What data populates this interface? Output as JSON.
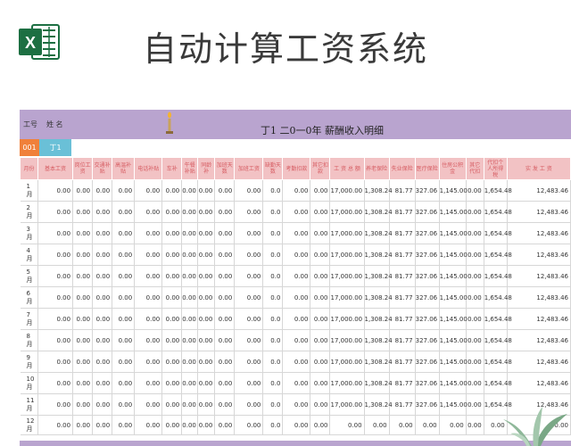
{
  "banner": {
    "title": "自动计算工资系统",
    "logo_letter": "X"
  },
  "sheet": {
    "header": {
      "emp_no_label": "工号",
      "name_label": "姓  名",
      "title": "丁1  二0一0年  薪酬收入明细"
    },
    "employee": {
      "id": "001",
      "name": "丁1"
    },
    "columns": [
      "月份",
      "基本工资",
      "岗位工资",
      "交通补贴",
      "高温补贴",
      "电话补贴",
      "车补",
      "午餐补贴",
      "同龄补",
      "加班天数",
      "加班工资",
      "缺勤天数",
      "考勤扣款",
      "其它扣款",
      "工 资 总 额",
      "养老保险",
      "失业保险",
      "医疗保险",
      "住房公积金",
      "其它代扣",
      "代扣个人所得税",
      "实 发 工 资"
    ],
    "rows": [
      {
        "month": "1月",
        "cells": [
          "0.00",
          "0.00",
          "0.00",
          "0.00",
          "0.00",
          "0.00",
          "0.00",
          "0.00",
          "0.00",
          "0.00",
          "0.0",
          "0.00",
          "0.00",
          "17,000.00",
          "1,308.24",
          "81.77",
          "327.06",
          "1,145.00",
          "0.00",
          "1,654.48",
          "12,483.46"
        ]
      },
      {
        "month": "2月",
        "cells": [
          "0.00",
          "0.00",
          "0.00",
          "0.00",
          "0.00",
          "0.00",
          "0.00",
          "0.00",
          "0.00",
          "0.00",
          "0.0",
          "0.00",
          "0.00",
          "17,000.00",
          "1,308.24",
          "81.77",
          "327.06",
          "1,145.00",
          "0.00",
          "1,654.48",
          "12,483.46"
        ]
      },
      {
        "month": "3月",
        "cells": [
          "0.00",
          "0.00",
          "0.00",
          "0.00",
          "0.00",
          "0.00",
          "0.00",
          "0.00",
          "0.00",
          "0.00",
          "0.0",
          "0.00",
          "0.00",
          "17,000.00",
          "1,308.24",
          "81.77",
          "327.06",
          "1,145.00",
          "0.00",
          "1,654.48",
          "12,483.46"
        ]
      },
      {
        "month": "4月",
        "cells": [
          "0.00",
          "0.00",
          "0.00",
          "0.00",
          "0.00",
          "0.00",
          "0.00",
          "0.00",
          "0.00",
          "0.00",
          "0.0",
          "0.00",
          "0.00",
          "17,000.00",
          "1,308.24",
          "81.77",
          "327.06",
          "1,145.00",
          "0.00",
          "1,654.48",
          "12,483.46"
        ]
      },
      {
        "month": "5月",
        "cells": [
          "0.00",
          "0.00",
          "0.00",
          "0.00",
          "0.00",
          "0.00",
          "0.00",
          "0.00",
          "0.00",
          "0.00",
          "0.0",
          "0.00",
          "0.00",
          "17,000.00",
          "1,308.24",
          "81.77",
          "327.06",
          "1,145.00",
          "0.00",
          "1,654.48",
          "12,483.46"
        ]
      },
      {
        "month": "6月",
        "cells": [
          "0.00",
          "0.00",
          "0.00",
          "0.00",
          "0.00",
          "0.00",
          "0.00",
          "0.00",
          "0.00",
          "0.00",
          "0.0",
          "0.00",
          "0.00",
          "17,000.00",
          "1,308.24",
          "81.77",
          "327.06",
          "1,145.00",
          "0.00",
          "1,654.48",
          "12,483.46"
        ]
      },
      {
        "month": "7月",
        "cells": [
          "0.00",
          "0.00",
          "0.00",
          "0.00",
          "0.00",
          "0.00",
          "0.00",
          "0.00",
          "0.00",
          "0.00",
          "0.0",
          "0.00",
          "0.00",
          "17,000.00",
          "1,308.24",
          "81.77",
          "327.06",
          "1,145.00",
          "0.00",
          "1,654.48",
          "12,483.46"
        ]
      },
      {
        "month": "8月",
        "cells": [
          "0.00",
          "0.00",
          "0.00",
          "0.00",
          "0.00",
          "0.00",
          "0.00",
          "0.00",
          "0.00",
          "0.00",
          "0.0",
          "0.00",
          "0.00",
          "17,000.00",
          "1,308.24",
          "81.77",
          "327.06",
          "1,145.00",
          "0.00",
          "1,654.48",
          "12,483.46"
        ]
      },
      {
        "month": "9月",
        "cells": [
          "0.00",
          "0.00",
          "0.00",
          "0.00",
          "0.00",
          "0.00",
          "0.00",
          "0.00",
          "0.00",
          "0.00",
          "0.0",
          "0.00",
          "0.00",
          "17,000.00",
          "1,308.24",
          "81.77",
          "327.06",
          "1,145.00",
          "0.00",
          "1,654.48",
          "12,483.46"
        ]
      },
      {
        "month": "10月",
        "cells": [
          "0.00",
          "0.00",
          "0.00",
          "0.00",
          "0.00",
          "0.00",
          "0.00",
          "0.00",
          "0.00",
          "0.00",
          "0.0",
          "0.00",
          "0.00",
          "17,000.00",
          "1,308.24",
          "81.77",
          "327.06",
          "1,145.00",
          "0.00",
          "1,654.48",
          "12,483.46"
        ]
      },
      {
        "month": "11月",
        "cells": [
          "0.00",
          "0.00",
          "0.00",
          "0.00",
          "0.00",
          "0.00",
          "0.00",
          "0.00",
          "0.00",
          "0.00",
          "0.0",
          "0.00",
          "0.00",
          "17,000.00",
          "1,308.24",
          "81.77",
          "327.06",
          "1,145.00",
          "0.00",
          "1,654.48",
          "12,483.46"
        ]
      },
      {
        "month": "12月",
        "cells": [
          "0.00",
          "0.00",
          "0.00",
          "0.00",
          "0.00",
          "0.00",
          "0.00",
          "0.00",
          "0.00",
          "0.00",
          "0.0",
          "0.00",
          "0.00",
          "0.00",
          "0.00",
          "0.00",
          "0.00",
          "0.00",
          "0.00",
          "0.00",
          "0.00"
        ]
      }
    ]
  },
  "colors": {
    "header_purple": "#b9a4cf",
    "column_header_pink": "#f2c2c4",
    "id_orange": "#f0803a",
    "name_cyan": "#6ac0d7",
    "excel_green": "#1d6f42"
  }
}
